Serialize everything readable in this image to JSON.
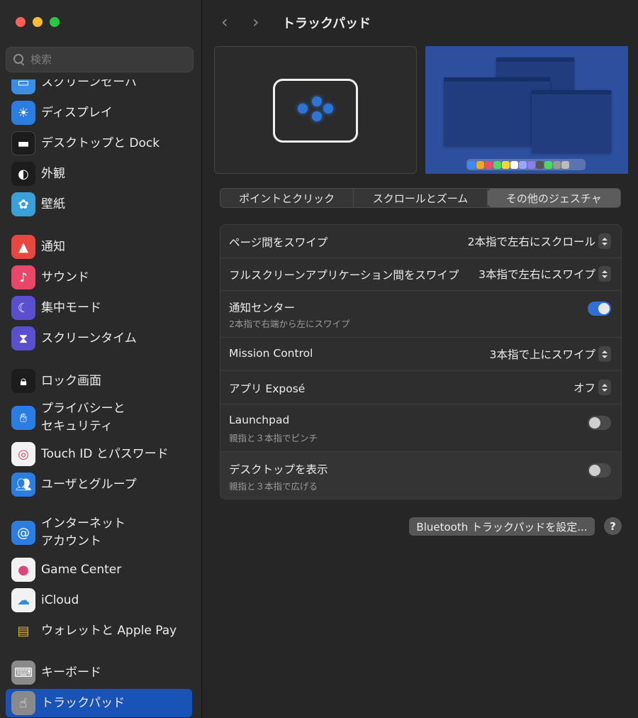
{
  "window": {
    "title": "トラックパッド"
  },
  "search": {
    "placeholder": "検索"
  },
  "sidebar": {
    "items": [
      {
        "label": "スクリーンセーバ",
        "icon": "screensaver-icon",
        "color": "#3a8ee6"
      },
      {
        "label": "ディスプレイ",
        "icon": "display-icon",
        "color": "#2a7de1"
      },
      {
        "label": "デスクトップと Dock",
        "icon": "dock-icon",
        "color": "#1c1c1c"
      },
      {
        "label": "外観",
        "icon": "appearance-icon",
        "color": "#1c1c1c"
      },
      {
        "label": "壁紙",
        "icon": "wallpaper-icon",
        "color": "#3aa0d8"
      },
      {
        "label": "通知",
        "icon": "notifications-icon",
        "color": "#e8473f"
      },
      {
        "label": "サウンド",
        "icon": "sound-icon",
        "color": "#e8476a"
      },
      {
        "label": "集中モード",
        "icon": "focus-icon",
        "color": "#5a4fcf"
      },
      {
        "label": "スクリーンタイム",
        "icon": "screentime-icon",
        "color": "#5a4fcf"
      },
      {
        "label": "ロック画面",
        "icon": "lock-screen-icon",
        "color": "#1c1c1c"
      },
      {
        "label": "プライバシーと\nセキュリティ",
        "icon": "privacy-hand-icon",
        "color": "#2a7de1"
      },
      {
        "label": "Touch ID とパスワード",
        "icon": "fingerprint-icon",
        "color": "#f2f2f2"
      },
      {
        "label": "ユーザとグループ",
        "icon": "users-icon",
        "color": "#2a7de1"
      },
      {
        "label": "インターネット\nアカウント",
        "icon": "at-icon",
        "color": "#2a7de1"
      },
      {
        "label": "Game Center",
        "icon": "game-center-icon",
        "color": "#f2f2f2"
      },
      {
        "label": "iCloud",
        "icon": "icloud-icon",
        "color": "#f2f2f2"
      },
      {
        "label": "ウォレットと Apple Pay",
        "icon": "wallet-icon",
        "color": "#2a2a2a"
      },
      {
        "label": "キーボード",
        "icon": "keyboard-icon",
        "color": "#8a8a8a"
      },
      {
        "label": "トラックパッド",
        "icon": "trackpad-icon",
        "color": "#8a8a8a",
        "active": true
      }
    ]
  },
  "tabs": [
    "ポイントとクリック",
    "スクロールとズーム",
    "その他のジェスチャ"
  ],
  "selected_tab": "その他のジェスチャ",
  "rows": [
    {
      "label": "ページ間をスワイプ",
      "value": "2本指で左右にスクロール",
      "type": "popup"
    },
    {
      "label": "フルスクリーンアプリケーション間をスワイプ",
      "value": "3本指で左右にスワイプ",
      "type": "popup"
    },
    {
      "label": "通知センター",
      "sub": "2本指で右端から左にスワイプ",
      "type": "toggle",
      "on": true
    },
    {
      "label": "Mission Control",
      "value": "3本指で上にスワイプ",
      "type": "popup"
    },
    {
      "label": "アプリ Exposé",
      "value": "オフ",
      "type": "popup"
    },
    {
      "label": "Launchpad",
      "sub": "親指と３本指でピンチ",
      "type": "toggle",
      "on": false
    },
    {
      "label": "デスクトップを表示",
      "sub": "親指と３本指で広げる",
      "type": "toggle",
      "on": false
    }
  ],
  "bluetooth_button": "Bluetooth トラックパッドを設定...",
  "help_button": "?",
  "accent_color": "#2f6fd9"
}
